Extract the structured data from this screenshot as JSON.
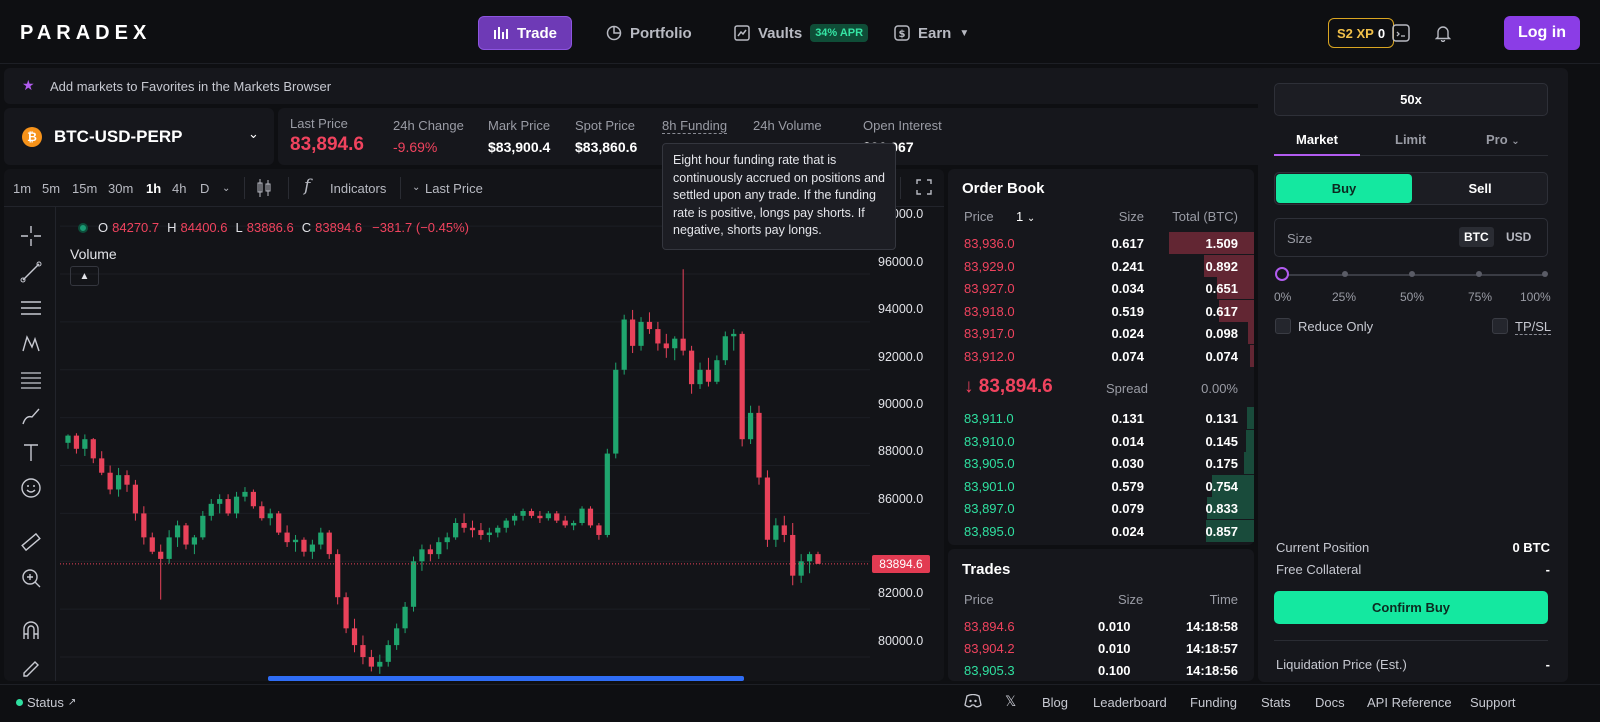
{
  "nav": {
    "logo": "PARADEX",
    "trade": "Trade",
    "portfolio": "Portfolio",
    "vaults": "Vaults",
    "vaults_apr": "34% APR",
    "earn": "Earn",
    "xp_label": "S2 XP",
    "xp_value": "0",
    "login": "Log in"
  },
  "favorites_hint": "Add markets to Favorites in the Markets Browser",
  "market": {
    "symbol": "BTC-USD-PERP",
    "icon": "bitcoin-icon"
  },
  "stats": {
    "last_price_label": "Last Price",
    "last_price": "83,894.6",
    "change_label": "24h Change",
    "change": "-9.69%",
    "mark_label": "Mark Price",
    "mark": "$83,900.4",
    "spot_label": "Spot Price",
    "spot": "$83,860.6",
    "funding_label": "8h Funding",
    "volume_label": "24h Volume",
    "oi_label": "Open Interest",
    "oi": "$96,067"
  },
  "tooltip": "Eight hour funding rate that is continuously accrued on positions and settled upon any trade. If the funding rate is positive, longs pay shorts. If negative, shorts pay longs.",
  "chart": {
    "timeframes": [
      "1m",
      "5m",
      "15m",
      "30m",
      "1h",
      "4h",
      "D"
    ],
    "selected_timeframe": "1h",
    "indicators": "Indicators",
    "price_type": "Last Price",
    "ohlc": {
      "o_label": "O",
      "o": "84270.7",
      "h_label": "H",
      "h": "84400.6",
      "l_label": "L",
      "l": "83886.6",
      "c_label": "C",
      "c": "83894.6",
      "chg": "−381.7 (−0.45%)"
    },
    "volume_label": "Volume",
    "price_tag": "83894.6",
    "y_labels": [
      "98000.0",
      "96000.0",
      "94000.0",
      "92000.0",
      "90000.0",
      "88000.0",
      "86000.0",
      "82000.0",
      "80000.0"
    ]
  },
  "chart_data": {
    "type": "candlestick",
    "ylim": [
      79000,
      98800
    ],
    "candles": [
      [
        88950,
        89300,
        88700,
        89250
      ],
      [
        89250,
        89350,
        88500,
        88700
      ],
      [
        88700,
        89300,
        88400,
        89100
      ],
      [
        89100,
        89150,
        88100,
        88300
      ],
      [
        88300,
        88600,
        87600,
        87700
      ],
      [
        87700,
        88000,
        86800,
        87000
      ],
      [
        87000,
        87900,
        86700,
        87600
      ],
      [
        87600,
        87800,
        86900,
        87200
      ],
      [
        87200,
        87400,
        85700,
        86000
      ],
      [
        86000,
        86300,
        84700,
        85000
      ],
      [
        85000,
        85200,
        84300,
        84400
      ],
      [
        84400,
        84700,
        82400,
        84100
      ],
      [
        84100,
        85300,
        83900,
        85000
      ],
      [
        85000,
        85700,
        84600,
        85500
      ],
      [
        85500,
        85600,
        84500,
        84700
      ],
      [
        84700,
        85100,
        84300,
        85000
      ],
      [
        85000,
        86100,
        84900,
        85900
      ],
      [
        85900,
        86600,
        85700,
        86400
      ],
      [
        86400,
        86800,
        86000,
        86600
      ],
      [
        86600,
        86800,
        85900,
        86000
      ],
      [
        86000,
        86900,
        85800,
        86700
      ],
      [
        86700,
        87100,
        86500,
        86900
      ],
      [
        86900,
        87000,
        86200,
        86300
      ],
      [
        86300,
        86500,
        85700,
        85800
      ],
      [
        85800,
        86200,
        85500,
        86000
      ],
      [
        86000,
        86100,
        85100,
        85200
      ],
      [
        85200,
        85500,
        84600,
        84800
      ],
      [
        84800,
        85100,
        84400,
        84900
      ],
      [
        84900,
        85000,
        84200,
        84400
      ],
      [
        84400,
        84900,
        84100,
        84700
      ],
      [
        84700,
        85400,
        84500,
        85200
      ],
      [
        85200,
        85300,
        84100,
        84300
      ],
      [
        84300,
        84500,
        82200,
        82500
      ],
      [
        82500,
        82700,
        81000,
        81200
      ],
      [
        81200,
        81600,
        80200,
        80500
      ],
      [
        80500,
        80900,
        79700,
        80000
      ],
      [
        80000,
        80300,
        79400,
        79600
      ],
      [
        79600,
        80100,
        79300,
        79800
      ],
      [
        79800,
        80700,
        79600,
        80500
      ],
      [
        80500,
        81400,
        80300,
        81200
      ],
      [
        81200,
        82300,
        81000,
        82100
      ],
      [
        82100,
        84200,
        81900,
        84000
      ],
      [
        84000,
        84700,
        83600,
        84500
      ],
      [
        84500,
        84700,
        84000,
        84300
      ],
      [
        84300,
        85000,
        84100,
        84800
      ],
      [
        84800,
        85200,
        84500,
        85000
      ],
      [
        85000,
        85800,
        84900,
        85600
      ],
      [
        85600,
        86000,
        85200,
        85400
      ],
      [
        85400,
        85700,
        85000,
        85300
      ],
      [
        85300,
        85600,
        84900,
        85100
      ],
      [
        85100,
        85400,
        84800,
        85200
      ],
      [
        85200,
        85500,
        85000,
        85400
      ],
      [
        85400,
        85800,
        85200,
        85700
      ],
      [
        85700,
        86000,
        85500,
        85900
      ],
      [
        85900,
        86200,
        85700,
        86100
      ],
      [
        86100,
        86200,
        85800,
        85900
      ],
      [
        85900,
        86100,
        85600,
        85800
      ],
      [
        85800,
        86100,
        85700,
        86000
      ],
      [
        86000,
        86100,
        85600,
        85700
      ],
      [
        85700,
        85900,
        85400,
        85500
      ],
      [
        85500,
        85700,
        85300,
        85600
      ],
      [
        85600,
        86300,
        85500,
        86200
      ],
      [
        86200,
        86300,
        85400,
        85500
      ],
      [
        85500,
        85600,
        84900,
        85100
      ],
      [
        85100,
        88700,
        85000,
        88500
      ],
      [
        88500,
        92300,
        88300,
        92000
      ],
      [
        92000,
        94300,
        91800,
        94100
      ],
      [
        94100,
        94500,
        92700,
        93000
      ],
      [
        93000,
        94200,
        92800,
        94000
      ],
      [
        94000,
        94400,
        93500,
        93700
      ],
      [
        93700,
        94000,
        92800,
        93100
      ],
      [
        93100,
        93500,
        92500,
        92900
      ],
      [
        92900,
        93400,
        92400,
        93300
      ],
      [
        93300,
        96200,
        92600,
        92800
      ],
      [
        92800,
        93000,
        91000,
        91400
      ],
      [
        91400,
        92300,
        91200,
        92000
      ],
      [
        92000,
        92500,
        91300,
        91500
      ],
      [
        91500,
        92600,
        91400,
        92400
      ],
      [
        92400,
        93600,
        92200,
        93400
      ],
      [
        93400,
        93700,
        92800,
        93500
      ],
      [
        93500,
        93600,
        88800,
        89100
      ],
      [
        89100,
        90500,
        88900,
        90200
      ],
      [
        90200,
        90500,
        87200,
        87500
      ],
      [
        87500,
        87800,
        84600,
        84900
      ],
      [
        84900,
        85800,
        84600,
        85500
      ],
      [
        85500,
        85900,
        84800,
        85100
      ],
      [
        85100,
        85600,
        83000,
        83400
      ],
      [
        83400,
        84300,
        83100,
        84000
      ],
      [
        84000,
        84400,
        83500,
        84300
      ],
      [
        84300,
        84400,
        83900,
        83895
      ]
    ]
  },
  "orderbook": {
    "title": "Order Book",
    "price_header": "Price",
    "grouping": "1",
    "size_header": "Size",
    "total_header": "Total (BTC)",
    "asks": [
      {
        "price": "83,936.0",
        "size": "0.617",
        "total": "1.509",
        "depth": 1.509
      },
      {
        "price": "83,929.0",
        "size": "0.241",
        "total": "0.892",
        "depth": 0.892
      },
      {
        "price": "83,927.0",
        "size": "0.034",
        "total": "0.651",
        "depth": 0.651
      },
      {
        "price": "83,918.0",
        "size": "0.519",
        "total": "0.617",
        "depth": 0.617
      },
      {
        "price": "83,917.0",
        "size": "0.024",
        "total": "0.098",
        "depth": 0.098
      },
      {
        "price": "83,912.0",
        "size": "0.074",
        "total": "0.074",
        "depth": 0.074
      }
    ],
    "mid_price": "83,894.6",
    "spread_label": "Spread",
    "spread_value": "0.00%",
    "bids": [
      {
        "price": "83,911.0",
        "size": "0.131",
        "total": "0.131",
        "depth": 0.131
      },
      {
        "price": "83,910.0",
        "size": "0.014",
        "total": "0.145",
        "depth": 0.145
      },
      {
        "price": "83,905.0",
        "size": "0.030",
        "total": "0.175",
        "depth": 0.175
      },
      {
        "price": "83,901.0",
        "size": "0.579",
        "total": "0.754",
        "depth": 0.754
      },
      {
        "price": "83,897.0",
        "size": "0.079",
        "total": "0.833",
        "depth": 0.833
      },
      {
        "price": "83,895.0",
        "size": "0.024",
        "total": "0.857",
        "depth": 0.857
      }
    ],
    "ask_color": "#f0435e",
    "bid_color": "#2fe0a0"
  },
  "trades": {
    "title": "Trades",
    "price_header": "Price",
    "size_header": "Size",
    "time_header": "Time",
    "rows": [
      {
        "price": "83,894.6",
        "size": "0.010",
        "time": "14:18:58",
        "side": "sell"
      },
      {
        "price": "83,904.2",
        "size": "0.010",
        "time": "14:18:57",
        "side": "sell"
      },
      {
        "price": "83,905.3",
        "size": "0.100",
        "time": "14:18:56",
        "side": "buy"
      }
    ]
  },
  "orderform": {
    "leverage": "50x",
    "tab_market": "Market",
    "tab_limit": "Limit",
    "tab_pro": "Pro",
    "buy": "Buy",
    "sell": "Sell",
    "size_label": "Size",
    "unit_btc": "BTC",
    "unit_usd": "USD",
    "size_percent": 0,
    "pcts": [
      "0%",
      "25%",
      "50%",
      "75%",
      "100%"
    ],
    "reduce_only": "Reduce Only",
    "tpsl": "TP/SL",
    "current_position_label": "Current Position",
    "current_position": "0 BTC",
    "free_collateral_label": "Free Collateral",
    "free_collateral": "-",
    "confirm": "Confirm Buy",
    "liq_label": "Liquidation Price (Est.)",
    "liq_value": "-"
  },
  "footer": {
    "status": "Status",
    "blog": "Blog",
    "leaderboard": "Leaderboard",
    "funding": "Funding",
    "stats": "Stats",
    "docs": "Docs",
    "api": "API Reference",
    "support": "Support"
  }
}
